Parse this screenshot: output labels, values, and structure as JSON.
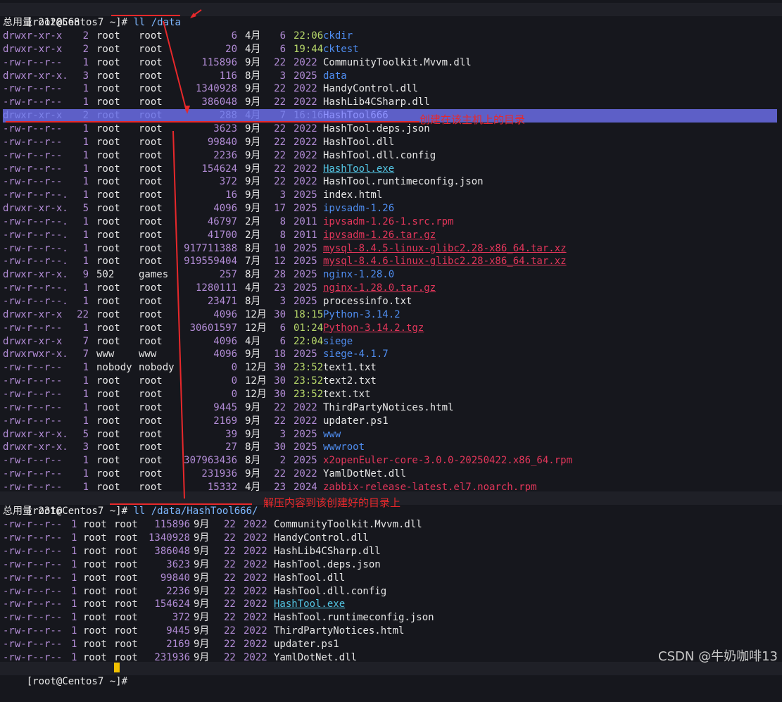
{
  "terminal": {
    "prompt": "[root@Centos7 ~]#",
    "command1": "ll /data",
    "total1": "总用量 2128568",
    "listing1": [
      {
        "perm": "drwxr-xr-x ",
        "links": "2",
        "owner": "root",
        "group": "root",
        "size": "6",
        "month": "4月",
        "day": "6",
        "time": "22:06",
        "name": "ckdir",
        "kind": "dir"
      },
      {
        "perm": "drwxr-xr-x ",
        "links": "2",
        "owner": "root",
        "group": "root",
        "size": "20",
        "month": "4月",
        "day": "6",
        "time": "19:44",
        "name": "cktest",
        "kind": "dir"
      },
      {
        "perm": "-rw-r--r-- ",
        "links": "1",
        "owner": "root",
        "group": "root",
        "size": "115896",
        "month": "9月",
        "day": "22",
        "time": "2022",
        "name": "CommunityToolkit.Mvvm.dll",
        "kind": "plain"
      },
      {
        "perm": "drwxr-xr-x.",
        "links": "3",
        "owner": "root",
        "group": "root",
        "size": "116",
        "month": "8月",
        "day": "3",
        "time": "2025",
        "name": "data",
        "kind": "dir"
      },
      {
        "perm": "-rw-r--r-- ",
        "links": "1",
        "owner": "root",
        "group": "root",
        "size": "1340928",
        "month": "9月",
        "day": "22",
        "time": "2022",
        "name": "HandyControl.dll",
        "kind": "plain"
      },
      {
        "perm": "-rw-r--r-- ",
        "links": "1",
        "owner": "root",
        "group": "root",
        "size": "386048",
        "month": "9月",
        "day": "22",
        "time": "2022",
        "name": "HashLib4CSharp.dll",
        "kind": "plain"
      },
      {
        "perm": "drwxr-xr-x ",
        "links": "2",
        "owner": "root",
        "group": "root",
        "size": "288",
        "month": "4月",
        "day": "7",
        "time": "16:16",
        "name": "HashTool666",
        "kind": "dir",
        "highlight": true
      },
      {
        "perm": "-rw-r--r-- ",
        "links": "1",
        "owner": "root",
        "group": "root",
        "size": "3623",
        "month": "9月",
        "day": "22",
        "time": "2022",
        "name": "HashTool.deps.json",
        "kind": "plain"
      },
      {
        "perm": "-rw-r--r-- ",
        "links": "1",
        "owner": "root",
        "group": "root",
        "size": "99840",
        "month": "9月",
        "day": "22",
        "time": "2022",
        "name": "HashTool.dll",
        "kind": "plain"
      },
      {
        "perm": "-rw-r--r-- ",
        "links": "1",
        "owner": "root",
        "group": "root",
        "size": "2236",
        "month": "9月",
        "day": "22",
        "time": "2022",
        "name": "HashTool.dll.config",
        "kind": "plain"
      },
      {
        "perm": "-rw-r--r-- ",
        "links": "1",
        "owner": "root",
        "group": "root",
        "size": "154624",
        "month": "9月",
        "day": "22",
        "time": "2022",
        "name": "HashTool.exe",
        "kind": "exe"
      },
      {
        "perm": "-rw-r--r-- ",
        "links": "1",
        "owner": "root",
        "group": "root",
        "size": "372",
        "month": "9月",
        "day": "22",
        "time": "2022",
        "name": "HashTool.runtimeconfig.json",
        "kind": "plain"
      },
      {
        "perm": "-rw-r--r--.",
        "links": "1",
        "owner": "root",
        "group": "root",
        "size": "16",
        "month": "9月",
        "day": "3",
        "time": "2025",
        "name": "index.html",
        "kind": "plain"
      },
      {
        "perm": "drwxr-xr-x.",
        "links": "5",
        "owner": "root",
        "group": "root",
        "size": "4096",
        "month": "9月",
        "day": "17",
        "time": "2025",
        "name": "ipvsadm-1.26",
        "kind": "dir"
      },
      {
        "perm": "-rw-r--r--.",
        "links": "1",
        "owner": "root",
        "group": "root",
        "size": "46797",
        "month": "2月",
        "day": "8",
        "time": "2011",
        "name": "ipvsadm-1.26-1.src.rpm",
        "kind": "rpm"
      },
      {
        "perm": "-rw-r--r--.",
        "links": "1",
        "owner": "root",
        "group": "root",
        "size": "41700",
        "month": "2月",
        "day": "8",
        "time": "2011",
        "name": "ipvsadm-1.26.tar.gz",
        "kind": "archive"
      },
      {
        "perm": "-rw-r--r--.",
        "links": "1",
        "owner": "root",
        "group": "root",
        "size": "917711388",
        "month": "8月",
        "day": "10",
        "time": "2025",
        "name": "mysql-8.4.5-linux-glibc2.28-x86_64.tar.xz",
        "kind": "archive"
      },
      {
        "perm": "-rw-r--r--.",
        "links": "1",
        "owner": "root",
        "group": "root",
        "size": "919559404",
        "month": "7月",
        "day": "12",
        "time": "2025",
        "name": "mysql-8.4.6-linux-glibc2.28-x86_64.tar.xz",
        "kind": "archive"
      },
      {
        "perm": "drwxr-xr-x.",
        "links": "9",
        "owner": "502",
        "group": "games",
        "size": "257",
        "month": "8月",
        "day": "28",
        "time": "2025",
        "name": "nginx-1.28.0",
        "kind": "dir"
      },
      {
        "perm": "-rw-r--r--.",
        "links": "1",
        "owner": "root",
        "group": "root",
        "size": "1280111",
        "month": "4月",
        "day": "23",
        "time": "2025",
        "name": "nginx-1.28.0.tar.gz",
        "kind": "archive"
      },
      {
        "perm": "-rw-r--r--.",
        "links": "1",
        "owner": "root",
        "group": "root",
        "size": "23471",
        "month": "8月",
        "day": "3",
        "time": "2025",
        "name": "processinfo.txt",
        "kind": "plain"
      },
      {
        "perm": "drwxr-xr-x ",
        "links": "22",
        "owner": "root",
        "group": "root",
        "size": "4096",
        "month": "12月",
        "day": "30",
        "time": "18:15",
        "name": "Python-3.14.2",
        "kind": "dir"
      },
      {
        "perm": "-rw-r--r-- ",
        "links": "1",
        "owner": "root",
        "group": "root",
        "size": "30601597",
        "month": "12月",
        "day": "6",
        "time": "01:24",
        "name": "Python-3.14.2.tgz",
        "kind": "archive"
      },
      {
        "perm": "drwxr-xr-x ",
        "links": "7",
        "owner": "root",
        "group": "root",
        "size": "4096",
        "month": "4月",
        "day": "6",
        "time": "22:04",
        "name": "siege",
        "kind": "dir"
      },
      {
        "perm": "drwxrwxr-x.",
        "links": "7",
        "owner": "www",
        "group": "www",
        "size": "4096",
        "month": "9月",
        "day": "18",
        "time": "2025",
        "name": "siege-4.1.7",
        "kind": "dir"
      },
      {
        "perm": "-rw-r--r-- ",
        "links": "1",
        "owner": "nobody",
        "group": "nobody",
        "size": "0",
        "month": "12月",
        "day": "30",
        "time": "23:52",
        "name": "text1.txt",
        "kind": "plain"
      },
      {
        "perm": "-rw-r--r-- ",
        "links": "1",
        "owner": "root",
        "group": "root",
        "size": "0",
        "month": "12月",
        "day": "30",
        "time": "23:52",
        "name": "text2.txt",
        "kind": "plain"
      },
      {
        "perm": "-rw-r--r-- ",
        "links": "1",
        "owner": "root",
        "group": "root",
        "size": "0",
        "month": "12月",
        "day": "30",
        "time": "23:52",
        "name": "text.txt",
        "kind": "plain"
      },
      {
        "perm": "-rw-r--r-- ",
        "links": "1",
        "owner": "root",
        "group": "root",
        "size": "9445",
        "month": "9月",
        "day": "22",
        "time": "2022",
        "name": "ThirdPartyNotices.html",
        "kind": "plain"
      },
      {
        "perm": "-rw-r--r-- ",
        "links": "1",
        "owner": "root",
        "group": "root",
        "size": "2169",
        "month": "9月",
        "day": "22",
        "time": "2022",
        "name": "updater.ps1",
        "kind": "plain"
      },
      {
        "perm": "drwxr-xr-x.",
        "links": "5",
        "owner": "root",
        "group": "root",
        "size": "39",
        "month": "9月",
        "day": "3",
        "time": "2025",
        "name": "www",
        "kind": "dir"
      },
      {
        "perm": "drwxr-xr-x.",
        "links": "3",
        "owner": "root",
        "group": "root",
        "size": "27",
        "month": "8月",
        "day": "30",
        "time": "2025",
        "name": "wwwroot",
        "kind": "dir"
      },
      {
        "perm": "-rw-r--r-- ",
        "links": "1",
        "owner": "root",
        "group": "root",
        "size": "307963436",
        "month": "8月",
        "day": "2",
        "time": "2025",
        "name": "x2openEuler-core-3.0.0-20250422.x86_64.rpm",
        "kind": "rpm"
      },
      {
        "perm": "-rw-r--r-- ",
        "links": "1",
        "owner": "root",
        "group": "root",
        "size": "231936",
        "month": "9月",
        "day": "22",
        "time": "2022",
        "name": "YamlDotNet.dll",
        "kind": "plain"
      },
      {
        "perm": "-rw-r--r-- ",
        "links": "1",
        "owner": "root",
        "group": "root",
        "size": "15332",
        "month": "4月",
        "day": "23",
        "time": "2024",
        "name": "zabbix-release-latest.el7.noarch.rpm",
        "kind": "rpm"
      }
    ],
    "command2": "ll /data/HashTool666/",
    "total2": "总用量 2316",
    "listing2": [
      {
        "perm": "-rw-r--r--",
        "links": "1",
        "owner": "root",
        "group": "root",
        "size": "115896",
        "month": "9月",
        "day": "22",
        "time": "2022",
        "name": "CommunityToolkit.Mvvm.dll",
        "kind": "plain"
      },
      {
        "perm": "-rw-r--r--",
        "links": "1",
        "owner": "root",
        "group": "root",
        "size": "1340928",
        "month": "9月",
        "day": "22",
        "time": "2022",
        "name": "HandyControl.dll",
        "kind": "plain"
      },
      {
        "perm": "-rw-r--r--",
        "links": "1",
        "owner": "root",
        "group": "root",
        "size": "386048",
        "month": "9月",
        "day": "22",
        "time": "2022",
        "name": "HashLib4CSharp.dll",
        "kind": "plain"
      },
      {
        "perm": "-rw-r--r--",
        "links": "1",
        "owner": "root",
        "group": "root",
        "size": "3623",
        "month": "9月",
        "day": "22",
        "time": "2022",
        "name": "HashTool.deps.json",
        "kind": "plain"
      },
      {
        "perm": "-rw-r--r--",
        "links": "1",
        "owner": "root",
        "group": "root",
        "size": "99840",
        "month": "9月",
        "day": "22",
        "time": "2022",
        "name": "HashTool.dll",
        "kind": "plain"
      },
      {
        "perm": "-rw-r--r--",
        "links": "1",
        "owner": "root",
        "group": "root",
        "size": "2236",
        "month": "9月",
        "day": "22",
        "time": "2022",
        "name": "HashTool.dll.config",
        "kind": "plain"
      },
      {
        "perm": "-rw-r--r--",
        "links": "1",
        "owner": "root",
        "group": "root",
        "size": "154624",
        "month": "9月",
        "day": "22",
        "time": "2022",
        "name": "HashTool.exe",
        "kind": "exe"
      },
      {
        "perm": "-rw-r--r--",
        "links": "1",
        "owner": "root",
        "group": "root",
        "size": "372",
        "month": "9月",
        "day": "22",
        "time": "2022",
        "name": "HashTool.runtimeconfig.json",
        "kind": "plain"
      },
      {
        "perm": "-rw-r--r--",
        "links": "1",
        "owner": "root",
        "group": "root",
        "size": "9445",
        "month": "9月",
        "day": "22",
        "time": "2022",
        "name": "ThirdPartyNotices.html",
        "kind": "plain"
      },
      {
        "perm": "-rw-r--r--",
        "links": "1",
        "owner": "root",
        "group": "root",
        "size": "2169",
        "month": "9月",
        "day": "22",
        "time": "2022",
        "name": "updater.ps1",
        "kind": "plain"
      },
      {
        "perm": "-rw-r--r--",
        "links": "1",
        "owner": "root",
        "group": "root",
        "size": "231936",
        "month": "9月",
        "day": "22",
        "time": "2022",
        "name": "YamlDotNet.dll",
        "kind": "plain"
      }
    ]
  },
  "annotations": {
    "created_dir": "创建在该主机上的目录",
    "extract_to": "解压内容到该创建好的目录上"
  },
  "watermark": "CSDN @牛奶咖啡13",
  "colors": {
    "background": "#16171d",
    "annotation": "#e8282b",
    "directory": "#4f8df0",
    "archive": "#e2365a",
    "permission": "#b28cd6",
    "highlight": "#5d5fc7",
    "cursor": "#f0c000"
  }
}
